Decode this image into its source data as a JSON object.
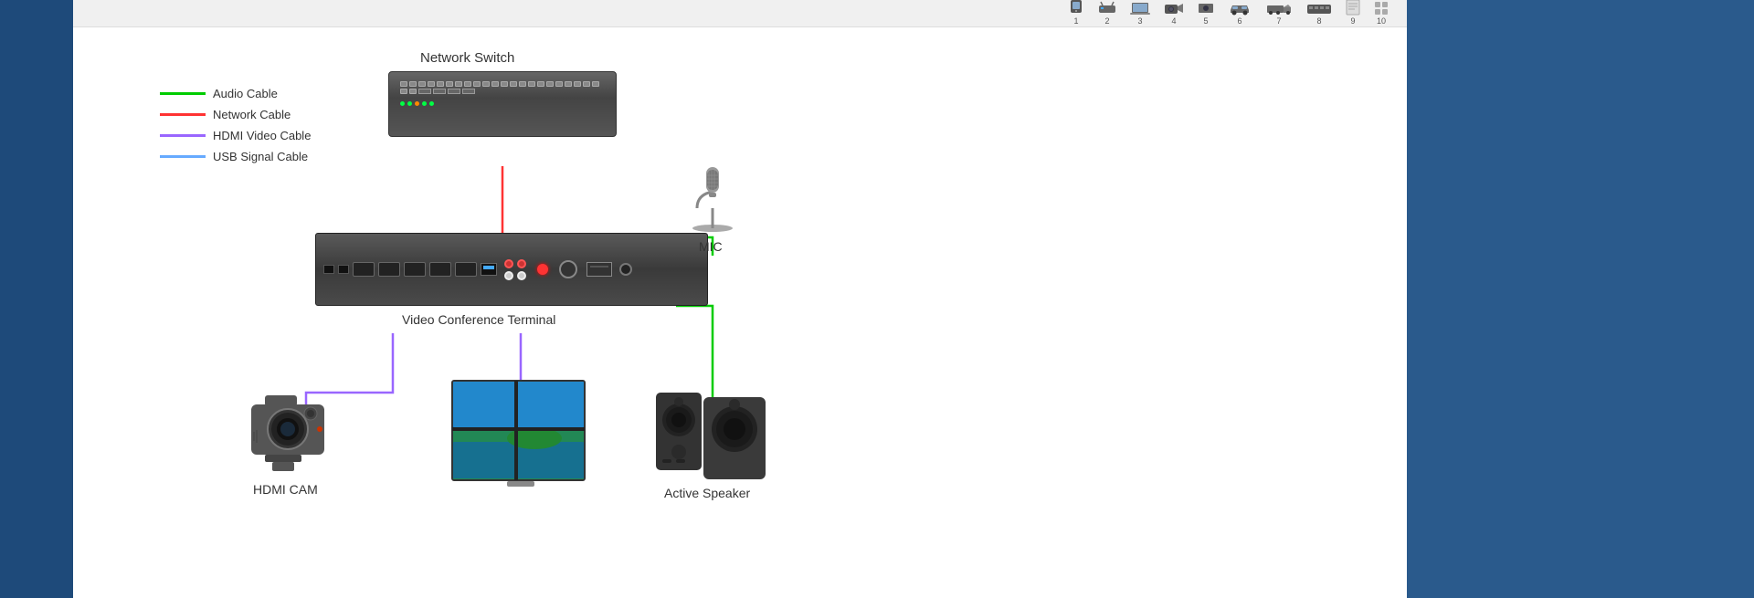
{
  "legend": {
    "items": [
      {
        "id": "audio-cable",
        "label": "Audio Cable",
        "color": "#00cc00"
      },
      {
        "id": "network-cable",
        "label": "Network Cable",
        "color": "#ff3333"
      },
      {
        "id": "hdmi-cable",
        "label": "HDMI Video Cable",
        "color": "#9966ff"
      },
      {
        "id": "usb-cable",
        "label": "USB Signal Cable",
        "color": "#66aaff"
      }
    ]
  },
  "devices": {
    "network_switch": {
      "label": "Network Switch"
    },
    "vct": {
      "label": "Video Conference Terminal"
    },
    "mic": {
      "label": "MIC"
    },
    "cam": {
      "label": "HDMI CAM"
    },
    "display": {
      "label": "Display"
    },
    "speaker": {
      "label": "Active Speaker"
    }
  },
  "nav": {
    "items": [
      {
        "num": "1"
      },
      {
        "num": "2"
      },
      {
        "num": "3"
      },
      {
        "num": "4"
      },
      {
        "num": "5"
      },
      {
        "num": "6"
      },
      {
        "num": "7"
      },
      {
        "num": "8"
      },
      {
        "num": "9"
      },
      {
        "num": "10"
      }
    ]
  }
}
